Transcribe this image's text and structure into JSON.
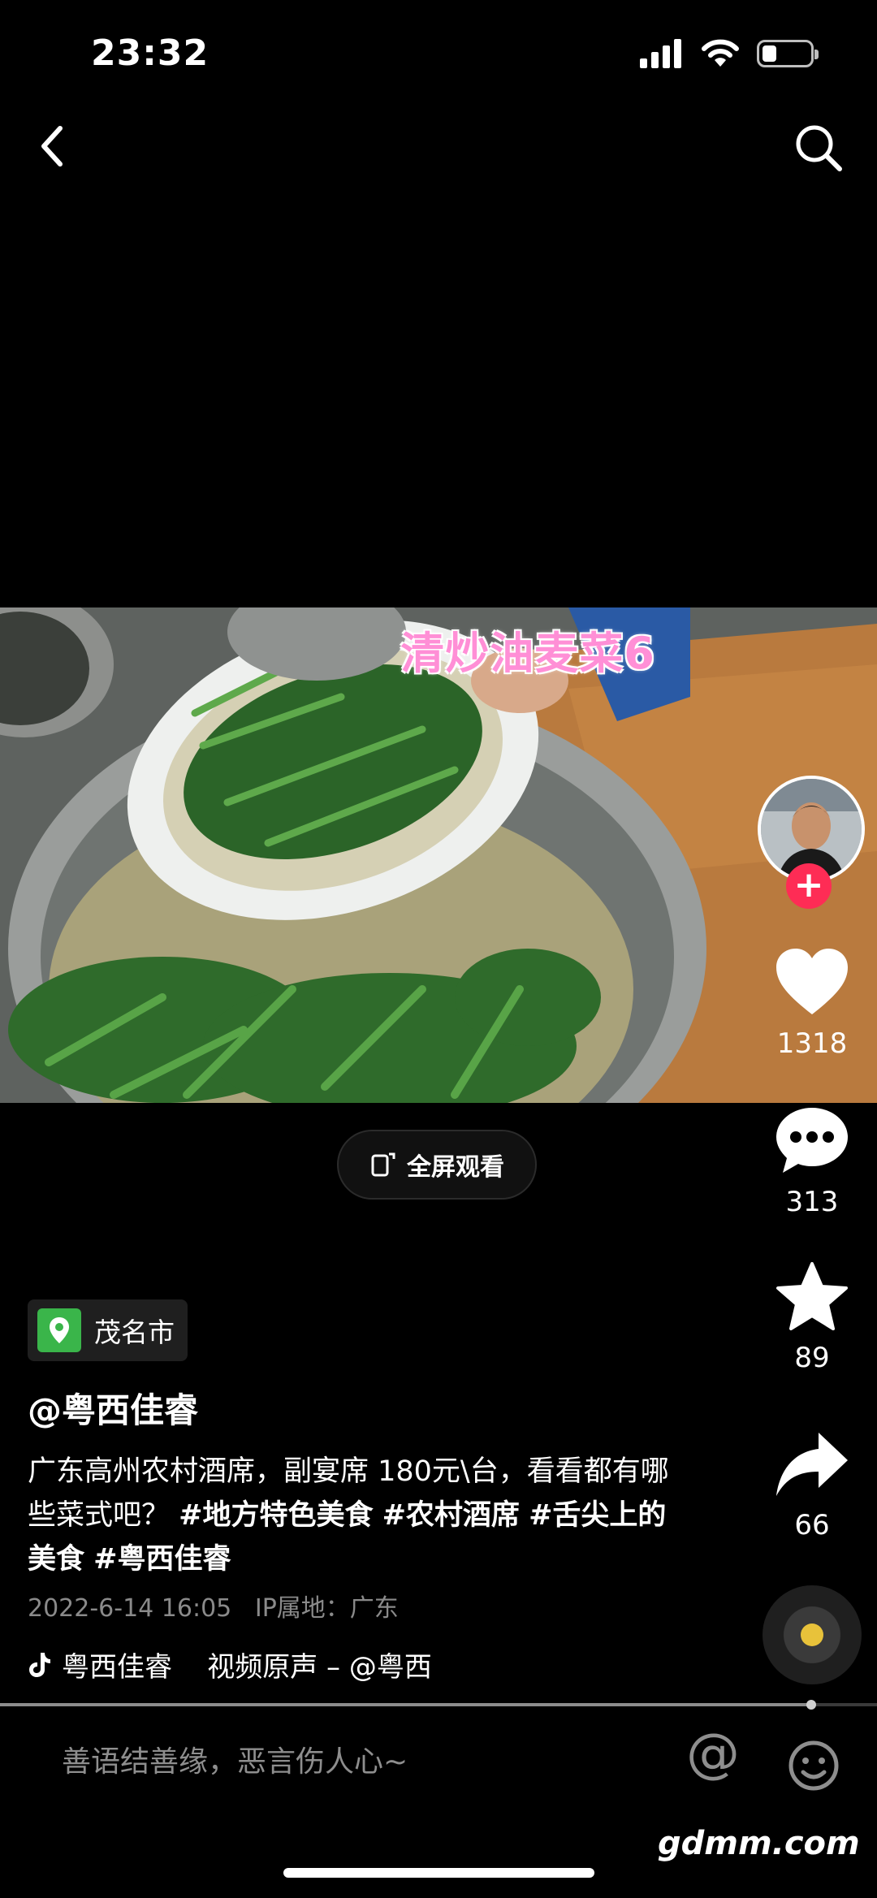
{
  "status_bar": {
    "time": "23:32",
    "battery_level": 0.3
  },
  "video": {
    "caption": "清炒油麦菜6"
  },
  "rail": {
    "likes": "1318",
    "comments": "313",
    "favorites": "89",
    "shares": "66"
  },
  "fullscreen_label": "全屏观看",
  "location": "茂名市",
  "author": "@粤西佳睿",
  "description": {
    "text": "广东高州农村酒席，副宴席 180元\\台，看看都有哪些菜式吧？ ",
    "tags": [
      "#地方特色美食",
      "#农村酒席",
      "#舌尖上的美食",
      "#粤西佳睿"
    ]
  },
  "meta_line": "2022-6-14 16:05   IP属地：广东",
  "music": "粤西佳睿    视频原声 – @粤西",
  "progress": 0.925,
  "comment_placeholder": "善语结善缘，恶言伤人心~",
  "at_symbol": "@",
  "watermark": "gdmm.com",
  "icons": [
    "back-icon",
    "search-icon",
    "signal-icon",
    "wifi-icon",
    "battery-icon",
    "heart-icon",
    "comment-icon",
    "star-icon",
    "share-icon",
    "location-pin-icon",
    "fullscreen-icon",
    "tiktok-note-icon",
    "emoji-icon",
    "music-disc-icon"
  ]
}
